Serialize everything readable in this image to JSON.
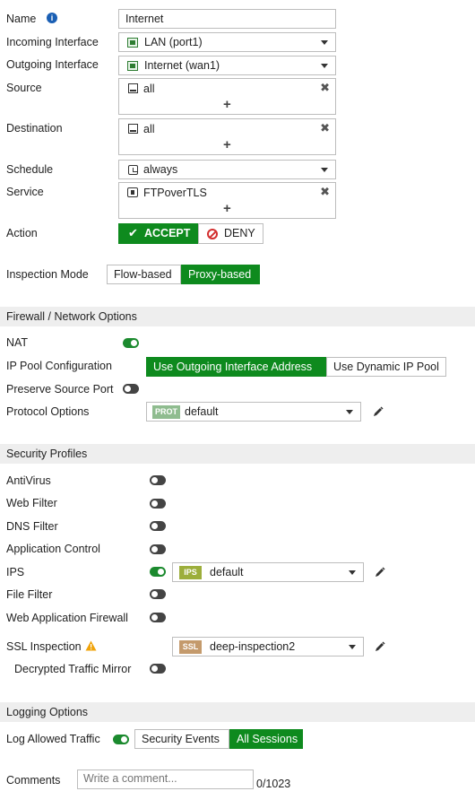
{
  "colors": {
    "accent": "#0e8a1e",
    "section_bg": "#eeeeee",
    "prot_tag": "#8fbc8f",
    "ips_tag": "#9cae3b",
    "ssl_tag": "#c49a6c",
    "warning": "#f0a30a"
  },
  "policy": {
    "name_label": "Name",
    "name_value": "Internet",
    "incoming_label": "Incoming Interface",
    "incoming_value": "LAN (port1)",
    "outgoing_label": "Outgoing Interface",
    "outgoing_value": "Internet (wan1)",
    "source_label": "Source",
    "source_value": "all",
    "destination_label": "Destination",
    "destination_value": "all",
    "schedule_label": "Schedule",
    "schedule_value": "always",
    "service_label": "Service",
    "service_value": "FTPoverTLS",
    "plus": "+",
    "remove": "✖",
    "action_label": "Action",
    "accept_label": "ACCEPT",
    "deny_label": "DENY",
    "inspection_label": "Inspection Mode",
    "flow_label": "Flow-based",
    "proxy_label": "Proxy-based"
  },
  "firewall": {
    "title": "Firewall / Network Options",
    "nat_label": "NAT",
    "ippool_label": "IP Pool Configuration",
    "ippool_outgoing": "Use Outgoing Interface Address",
    "ippool_dynamic": "Use Dynamic IP Pool",
    "preserve_label": "Preserve Source Port",
    "protocol_label": "Protocol Options",
    "protocol_tag": "PROT",
    "protocol_value": "default"
  },
  "security": {
    "title": "Security Profiles",
    "antivirus": "AntiVirus",
    "webfilter": "Web Filter",
    "dnsfilter": "DNS Filter",
    "appcontrol": "Application Control",
    "ips": "IPS",
    "ips_tag": "IPS",
    "ips_value": "default",
    "filefilter": "File Filter",
    "waf": "Web Application Firewall",
    "ssl": "SSL Inspection",
    "ssl_tag": "SSL",
    "ssl_value": "deep-inspection2",
    "mirror": "Decrypted Traffic Mirror"
  },
  "logging": {
    "title": "Logging Options",
    "log_label": "Log Allowed Traffic",
    "security_events": "Security Events",
    "all_sessions": "All Sessions",
    "comments_label": "Comments",
    "comments_placeholder": "Write a comment...",
    "counter": "0/1023"
  }
}
